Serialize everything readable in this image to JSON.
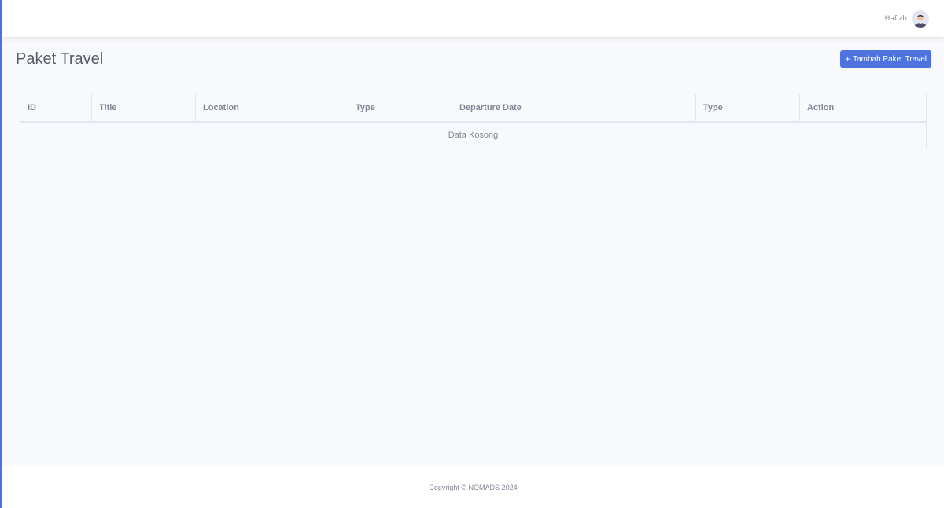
{
  "topbar": {
    "user_name": "Hafizh",
    "avatar_icon": "user-avatar-icon"
  },
  "header": {
    "title": "Paket Travel",
    "add_button_icon": "+",
    "add_button_label": "Tambah Paket Travel"
  },
  "table": {
    "columns": [
      "ID",
      "Title",
      "Location",
      "Type",
      "Departure Date",
      "Type",
      "Action"
    ],
    "empty_message": "Data Kosong"
  },
  "footer": {
    "copyright": "Copyright © NOMADS 2024"
  },
  "colors": {
    "primary": "#4e73df",
    "text_muted": "#858796",
    "title": "#5a5c69",
    "background": "#f8f9fc",
    "border": "#e3e6f0"
  }
}
